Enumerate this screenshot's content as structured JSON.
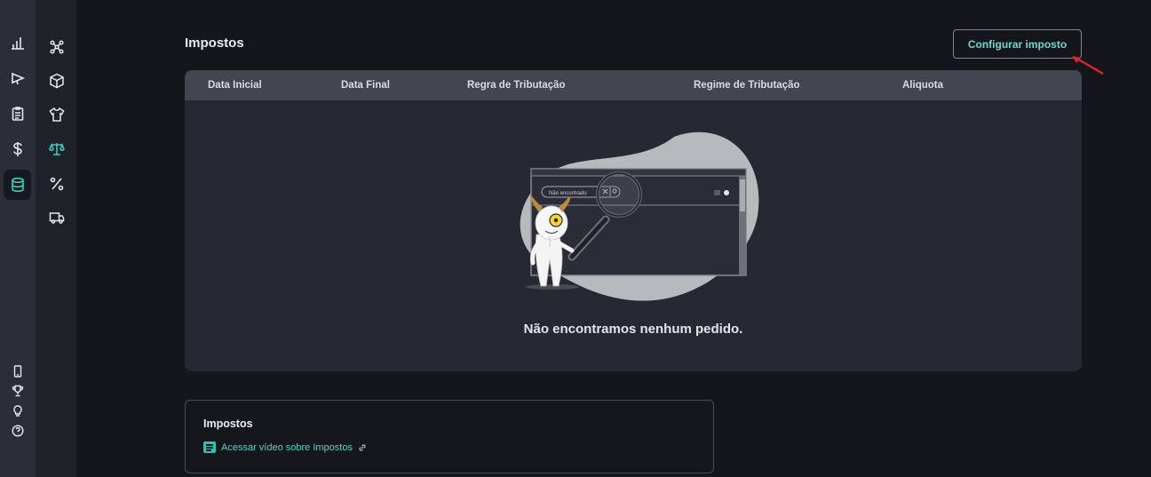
{
  "page": {
    "title": "Impostos",
    "config_button": "Configurar imposto"
  },
  "table": {
    "columns": [
      "Data Inicial",
      "Data Final",
      "Regra de Tributação",
      "Regime de Tributação",
      "Aliquota"
    ],
    "empty_message": "Não encontramos nenhum pedido.",
    "illustration_search_text": "Não encontrado"
  },
  "help": {
    "title": "Impostos",
    "link_label": "Acessar vídeo sobre Impostos"
  },
  "sidebar_primary": [
    "chart-icon",
    "megaphone-icon",
    "clipboard-icon",
    "dollar-icon",
    "database-icon"
  ],
  "sidebar_primary_bottom": [
    "mobile-icon",
    "trophy-icon",
    "lightbulb-icon",
    "help-icon"
  ],
  "sidebar_secondary": [
    "integrations-icon",
    "package-icon",
    "shirt-icon",
    "scale-icon",
    "percent-icon",
    "truck-icon"
  ],
  "colors": {
    "accent": "#27b3a8",
    "active_icon": "#3fd0c2",
    "annotation_arrow": "#e0242b"
  }
}
